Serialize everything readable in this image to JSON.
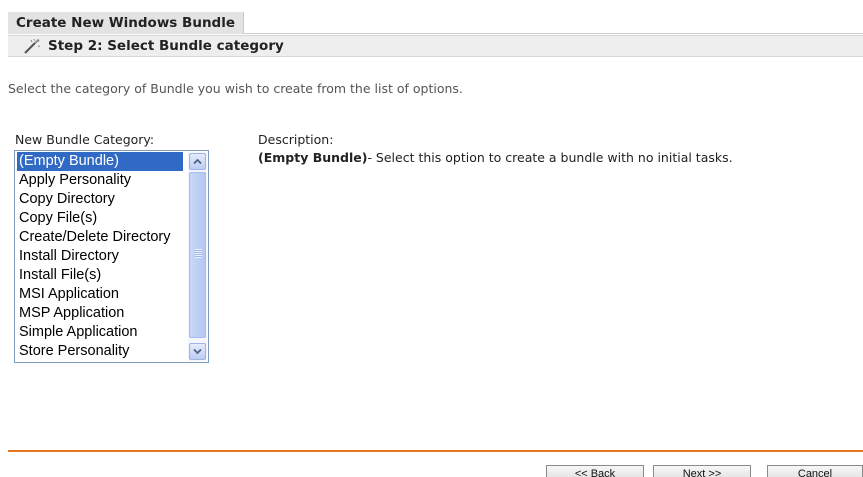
{
  "header": {
    "title": "Create New Windows Bundle",
    "step": "Step 2: Select Bundle category",
    "step_icon": "wand-icon"
  },
  "intro": "Select the category of Bundle you wish to create from the list of options.",
  "category": {
    "label": "New Bundle Category:",
    "items": [
      "(Empty Bundle)",
      "Apply Personality",
      "Copy Directory",
      "Copy File(s)",
      "Create/Delete Directory",
      "Install Directory",
      "Install File(s)",
      "MSI Application",
      "MSP Application",
      "Simple Application",
      "Store Personality"
    ],
    "selected": "(Empty Bundle)"
  },
  "description": {
    "label": "Description:",
    "name": "(Empty Bundle)",
    "text": "- Select this option to create a bundle with no initial tasks."
  },
  "buttons": {
    "back": "<< Back",
    "next": "Next >>",
    "cancel": "Cancel"
  },
  "colors": {
    "accent_line": "#e8761d",
    "selection": "#316ac5"
  }
}
